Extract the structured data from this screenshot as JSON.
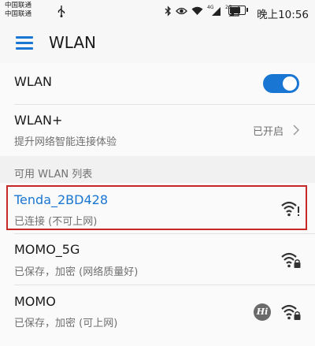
{
  "status_bar": {
    "carrier_1": "中国联通",
    "carrier_2": "中国联通",
    "network_1": "4G",
    "network_2": "2G",
    "time": "晚上10:56",
    "battery_level": 0.75
  },
  "app_bar": {
    "title": "WLAN"
  },
  "wlan_toggle": {
    "label": "WLAN",
    "enabled": true
  },
  "wlan_plus": {
    "label": "WLAN+",
    "description": "提升网络智能连接体验",
    "status": "已开启"
  },
  "available_list": {
    "header": "可用 WLAN 列表",
    "networks": [
      {
        "ssid": "Tenda_2BD428",
        "status": "已连接 (不可上网)",
        "connected": true,
        "icon": "wifi-warning-icon"
      },
      {
        "ssid": "MOMO_5G",
        "status": "已保存，加密 (网络质量好)",
        "connected": false,
        "icon": "wifi-lock-icon"
      },
      {
        "ssid": "MOMO",
        "status": "已保存，加密 (可上网)",
        "connected": false,
        "icon": "wifi-lock-icon",
        "badge": "Hi"
      }
    ]
  },
  "colors": {
    "accent": "#1976d2",
    "highlight_border": "#c62828"
  }
}
